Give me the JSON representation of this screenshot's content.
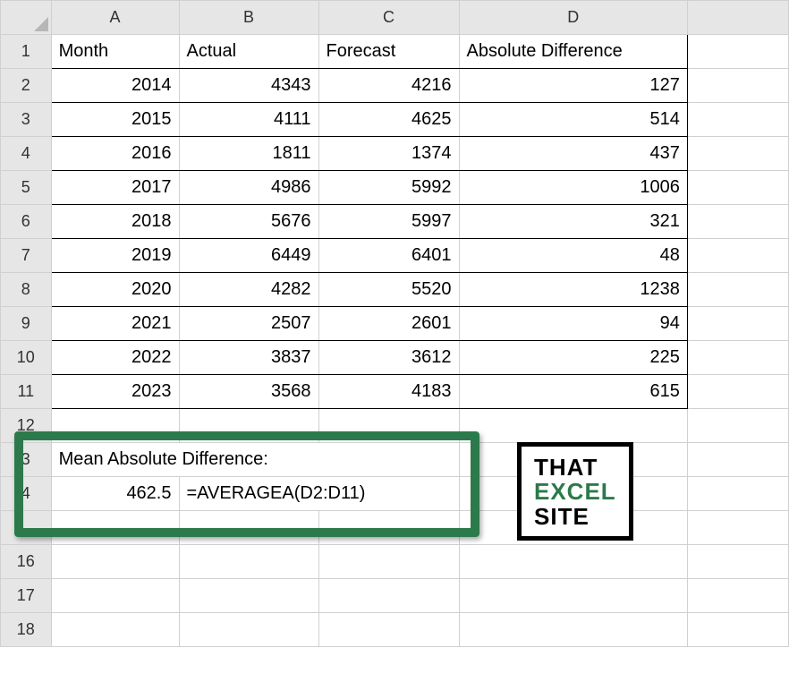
{
  "columns": [
    "A",
    "B",
    "C",
    "D"
  ],
  "headers": {
    "A": "Month",
    "B": "Actual",
    "C": "Forecast",
    "D": "Absolute Difference"
  },
  "rows": [
    {
      "n": 2,
      "A": "2014",
      "B": "4343",
      "C": "4216",
      "D": "127"
    },
    {
      "n": 3,
      "A": "2015",
      "B": "4111",
      "C": "4625",
      "D": "514"
    },
    {
      "n": 4,
      "A": "2016",
      "B": "1811",
      "C": "1374",
      "D": "437"
    },
    {
      "n": 5,
      "A": "2017",
      "B": "4986",
      "C": "5992",
      "D": "1006"
    },
    {
      "n": 6,
      "A": "2018",
      "B": "5676",
      "C": "5997",
      "D": "321"
    },
    {
      "n": 7,
      "A": "2019",
      "B": "6449",
      "C": "6401",
      "D": "48"
    },
    {
      "n": 8,
      "A": "2020",
      "B": "4282",
      "C": "5520",
      "D": "1238"
    },
    {
      "n": 9,
      "A": "2021",
      "B": "2507",
      "C": "2601",
      "D": "94"
    },
    {
      "n": 10,
      "A": "2022",
      "B": "3837",
      "C": "3612",
      "D": "225"
    },
    {
      "n": 11,
      "A": "2023",
      "B": "3568",
      "C": "4183",
      "D": "615"
    }
  ],
  "summary": {
    "label": "Mean Absolute Difference:",
    "value": "462.5",
    "formula": "=AVERAGEA(D2:D11)"
  },
  "rowlabels": {
    "r12": "12",
    "r13": "3",
    "r14": "4",
    "r15": "",
    "r16": "16",
    "r17": "17",
    "r18": "18"
  },
  "logo": {
    "w1": "THAT",
    "w2": "EXCEL",
    "w3": "SITE"
  },
  "chart_data": {
    "type": "table",
    "title": "Mean Absolute Difference",
    "columns": [
      "Month",
      "Actual",
      "Forecast",
      "Absolute Difference"
    ],
    "data": [
      {
        "Month": 2014,
        "Actual": 4343,
        "Forecast": 4216,
        "Absolute Difference": 127
      },
      {
        "Month": 2015,
        "Actual": 4111,
        "Forecast": 4625,
        "Absolute Difference": 514
      },
      {
        "Month": 2016,
        "Actual": 1811,
        "Forecast": 1374,
        "Absolute Difference": 437
      },
      {
        "Month": 2017,
        "Actual": 4986,
        "Forecast": 5992,
        "Absolute Difference": 1006
      },
      {
        "Month": 2018,
        "Actual": 5676,
        "Forecast": 5997,
        "Absolute Difference": 321
      },
      {
        "Month": 2019,
        "Actual": 6449,
        "Forecast": 6401,
        "Absolute Difference": 48
      },
      {
        "Month": 2020,
        "Actual": 4282,
        "Forecast": 5520,
        "Absolute Difference": 1238
      },
      {
        "Month": 2021,
        "Actual": 2507,
        "Forecast": 2601,
        "Absolute Difference": 94
      },
      {
        "Month": 2022,
        "Actual": 3837,
        "Forecast": 3612,
        "Absolute Difference": 225
      },
      {
        "Month": 2023,
        "Actual": 3568,
        "Forecast": 4183,
        "Absolute Difference": 615
      }
    ],
    "mean_absolute_difference": 462.5,
    "formula": "=AVERAGEA(D2:D11)"
  }
}
